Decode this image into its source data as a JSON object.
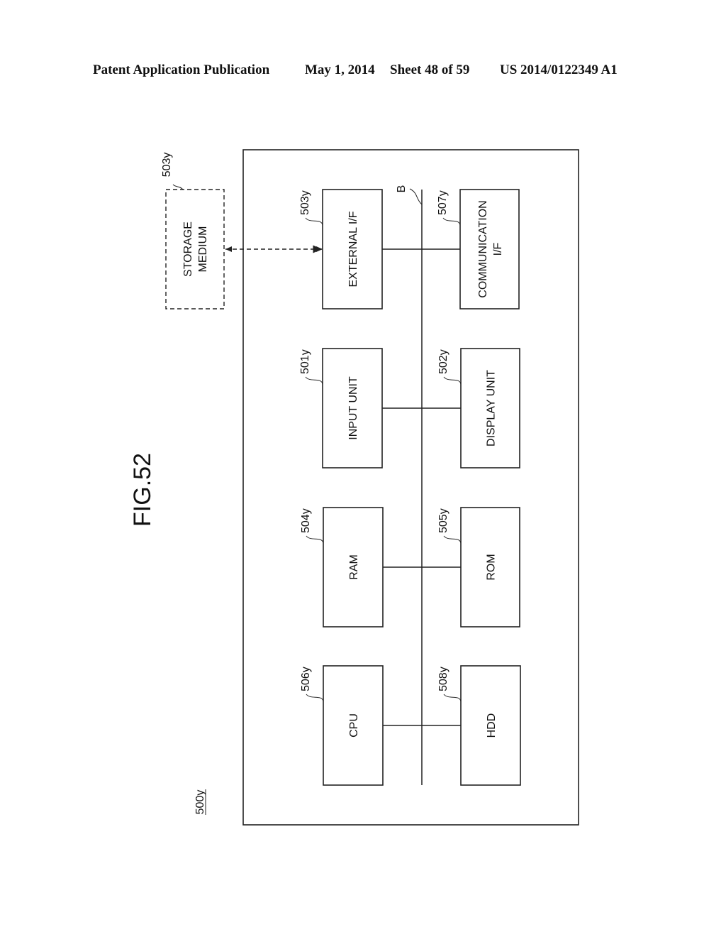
{
  "header": {
    "publication": "Patent Application Publication",
    "date": "May 1, 2014",
    "sheet": "Sheet 48 of 59",
    "number": "US 2014/0122349 A1"
  },
  "figure": {
    "title": "FIG.52",
    "system_ref": "500y",
    "bus_ref": "B",
    "storage_medium": {
      "lines": [
        "STORAGE",
        "MEDIUM"
      ],
      "ref": "503y"
    },
    "blocks": [
      {
        "id": "external-if",
        "lines": [
          "EXTERNAL I/F"
        ],
        "ref": "503y"
      },
      {
        "id": "communication-if",
        "lines": [
          "COMMUNICATION",
          "I/F"
        ],
        "ref": "507y"
      },
      {
        "id": "input-unit",
        "lines": [
          "INPUT UNIT"
        ],
        "ref": "501y"
      },
      {
        "id": "display-unit",
        "lines": [
          "DISPLAY UNIT"
        ],
        "ref": "502y"
      },
      {
        "id": "ram",
        "lines": [
          "RAM"
        ],
        "ref": "504y"
      },
      {
        "id": "rom",
        "lines": [
          "ROM"
        ],
        "ref": "505y"
      },
      {
        "id": "cpu",
        "lines": [
          "CPU"
        ],
        "ref": "506y"
      },
      {
        "id": "hdd",
        "lines": [
          "HDD"
        ],
        "ref": "508y"
      }
    ]
  }
}
